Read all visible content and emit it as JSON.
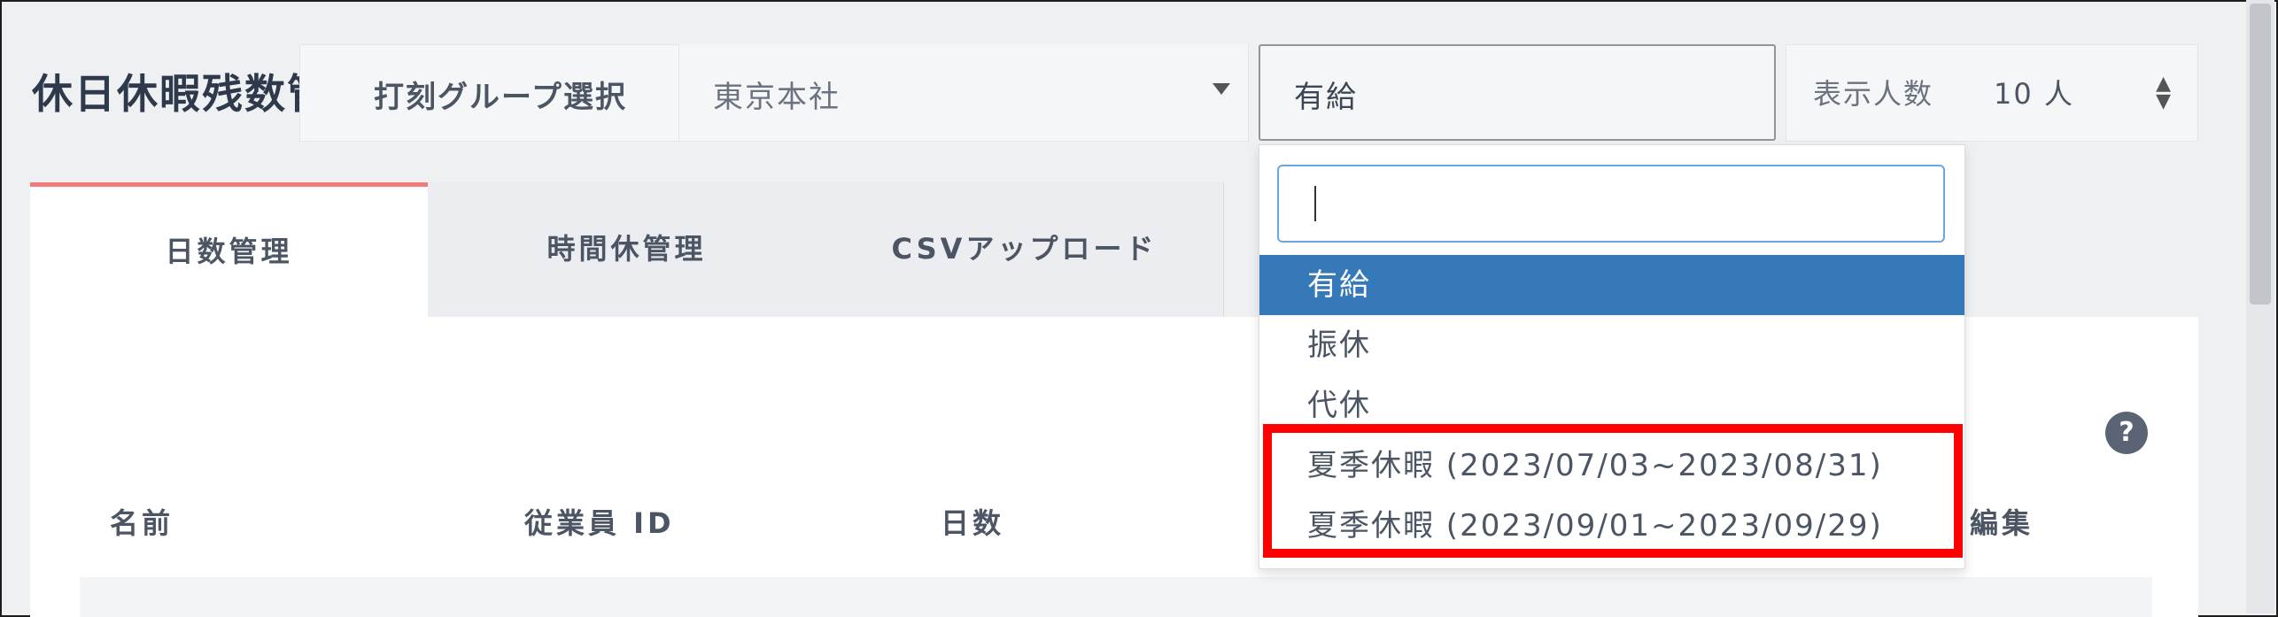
{
  "header": {
    "title": "休日休暇残数管理"
  },
  "filters": {
    "group_label": "打刻グループ選択",
    "group_value": "東京本社",
    "leave_type_value": "有給",
    "count_label": "表示人数",
    "count_value": "10 人"
  },
  "tabs": [
    {
      "label": "日数管理",
      "active": true
    },
    {
      "label": "時間休管理",
      "active": false
    },
    {
      "label": "CSVアップロード",
      "active": false
    }
  ],
  "table": {
    "headers": [
      "名前",
      "従業員 ID",
      "日数",
      "編集"
    ]
  },
  "dropdown": {
    "search_value": "",
    "options": [
      {
        "label": "有給",
        "selected": true
      },
      {
        "label": "振休",
        "selected": false
      },
      {
        "label": "代休",
        "selected": false
      },
      {
        "label": "夏季休暇 (2023/07/03~2023/08/31)",
        "selected": false
      },
      {
        "label": "夏季休暇 (2023/09/01~2023/09/29)",
        "selected": false
      }
    ]
  },
  "icons": {
    "help": "question-circle-icon",
    "help_glyph": "?"
  },
  "colors": {
    "accent_tab": "#f27a7a",
    "selected_option": "#3579b8",
    "highlight_box": "#ff0000"
  }
}
